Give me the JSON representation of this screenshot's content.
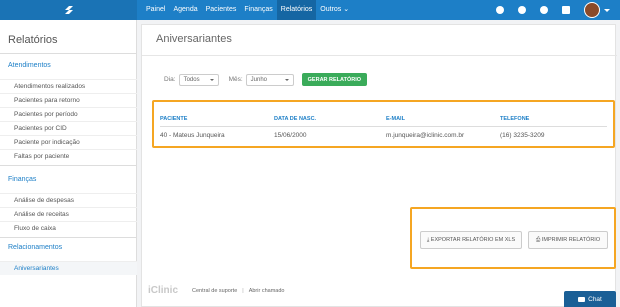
{
  "nav": {
    "items": [
      "Painel",
      "Agenda",
      "Pacientes",
      "Finanças",
      "Relatórios",
      "Outros"
    ],
    "active": "Relatórios"
  },
  "sidebar": {
    "title": "Relatórios",
    "groups": [
      {
        "label": "Atendimentos",
        "items": [
          "Atendimentos realizados",
          "Pacientes para retorno",
          "Pacientes por período",
          "Pacientes por CID",
          "Paciente por indicação",
          "Faltas por paciente"
        ]
      },
      {
        "label": "Finanças",
        "items": [
          "Análise de despesas",
          "Análise de receitas",
          "Fluxo de caixa"
        ]
      },
      {
        "label": "Relacionamentos",
        "items": [
          "Aniversariantes"
        ]
      }
    ]
  },
  "main": {
    "title": "Aniversariantes",
    "filters": {
      "dia_label": "Dia:",
      "dia_value": "Todos",
      "mes_label": "Mês:",
      "mes_value": "Junho",
      "button": "GERAR RELATÓRIO"
    },
    "table": {
      "headers": [
        "PACIENTE",
        "DATA DE NASC.",
        "E-MAIL",
        "TELEFONE"
      ],
      "rows": [
        [
          "40 - Mateus Junqueira",
          "15/06/2000",
          "m.junqueira@iclinic.com.br",
          "(16) 3235-3209"
        ]
      ]
    },
    "export_xls": "EXPORTAR RELATÓRIO EM XLS",
    "print": "IMPRIMIR RELATÓRIO"
  },
  "footer": {
    "logo": "iClinic",
    "support": "Central de suporte",
    "sep": "|",
    "ticket": "Abrir chamado"
  },
  "chat": {
    "label": "Chat"
  },
  "colors": {
    "brand": "#1d7fc7",
    "highlight": "#f5a623",
    "green": "#3aab5a"
  }
}
